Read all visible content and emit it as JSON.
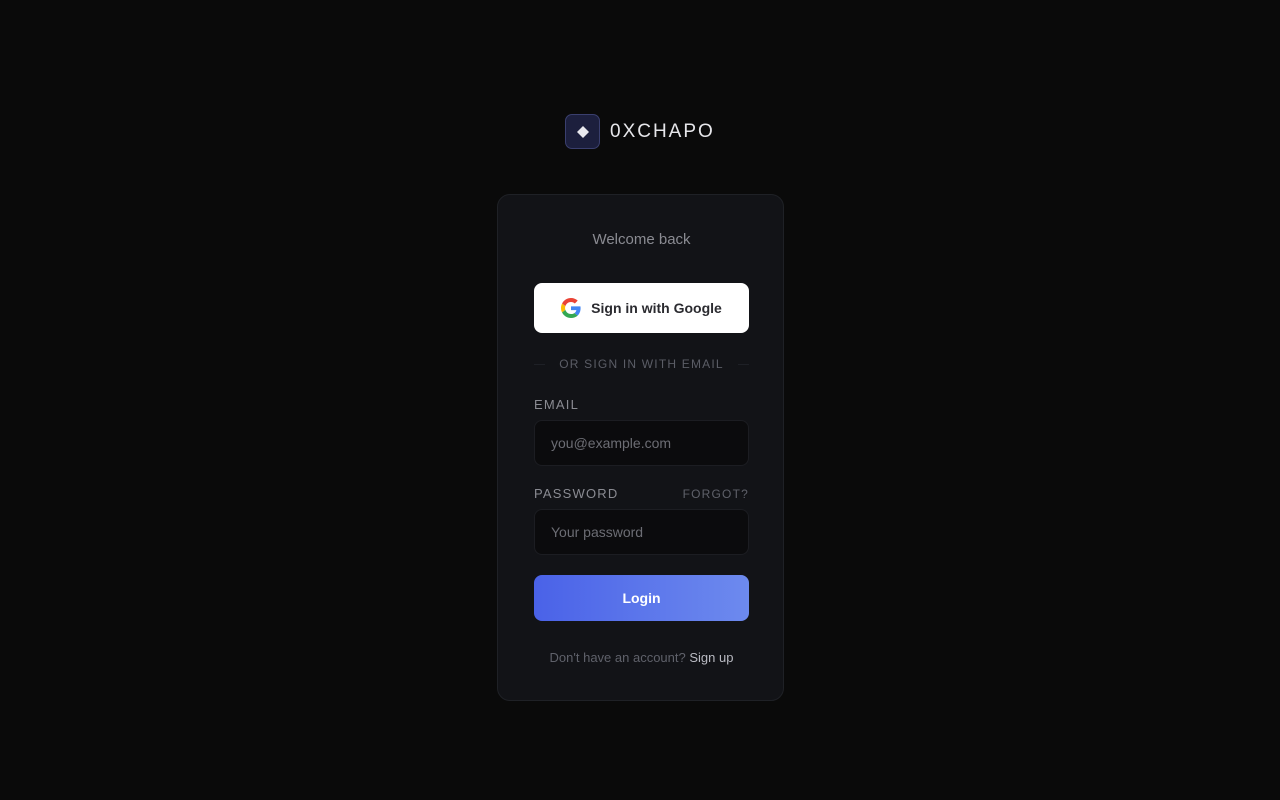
{
  "brand": {
    "name": "0XCHAPO",
    "logo_icon": "diamond-icon"
  },
  "card": {
    "welcome": "Welcome back",
    "google_button": {
      "label": "Sign in with Google",
      "icon": "google-icon"
    },
    "divider_text": "OR SIGN IN WITH EMAIL",
    "email": {
      "label": "EMAIL",
      "value": "",
      "placeholder": "you@example.com"
    },
    "password": {
      "label": "PASSWORD",
      "forgot": "FORGOT?",
      "value": "",
      "placeholder": "Your password"
    },
    "login_label": "Login",
    "signup_prompt": "Don't have an account?",
    "signup_link": "Sign up"
  },
  "colors": {
    "background": "#0a0a0a",
    "card": "#121317",
    "accent_start": "#4a62e8",
    "accent_end": "#6d8aee"
  }
}
